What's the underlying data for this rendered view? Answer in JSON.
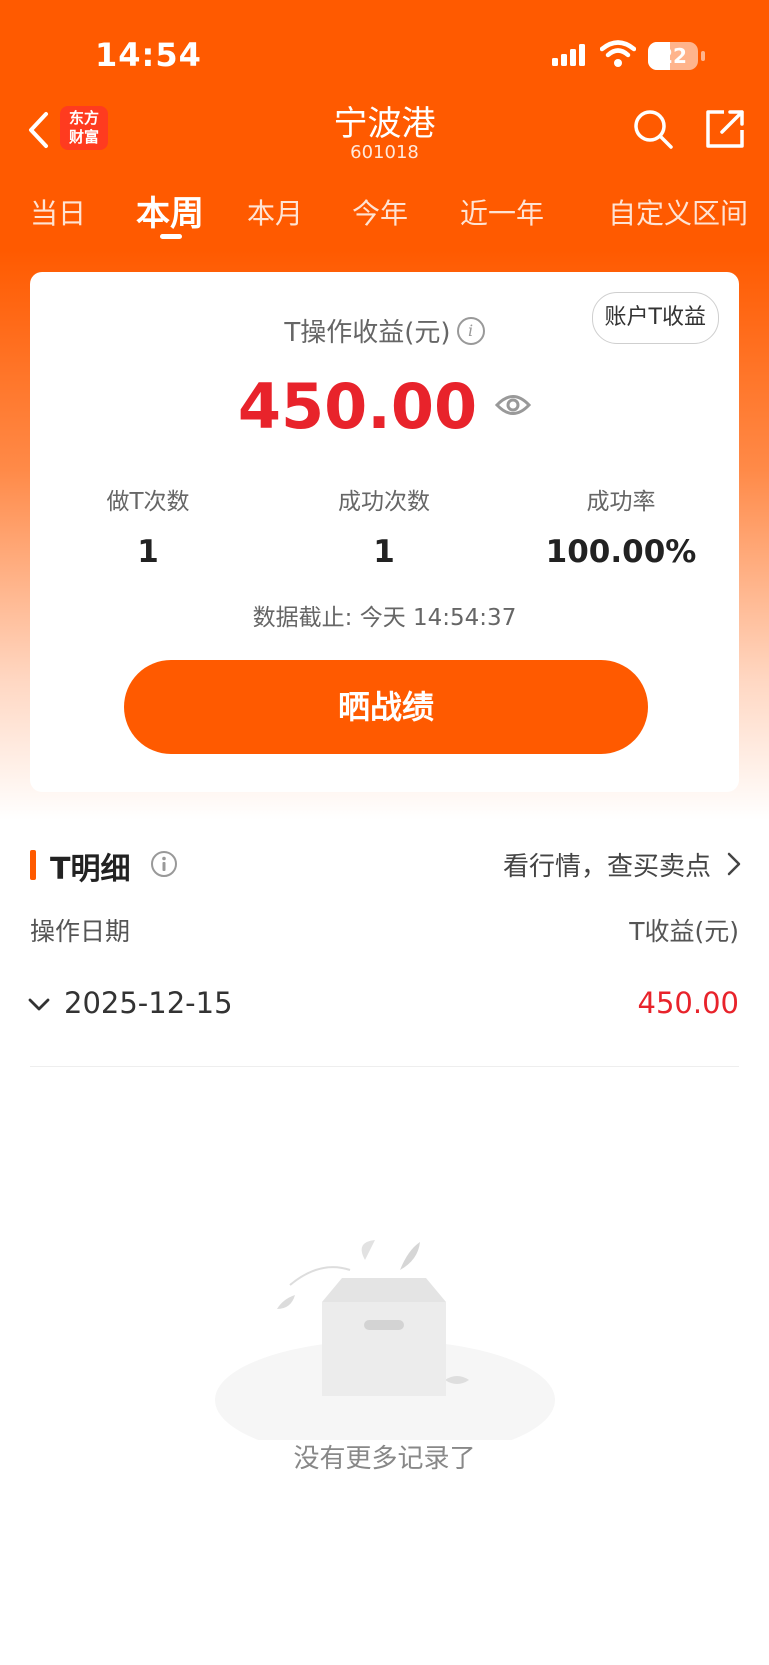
{
  "status_bar": {
    "time": "14:54",
    "battery": "22"
  },
  "nav": {
    "logo_line1": "东方",
    "logo_line2": "财富",
    "title": "宁波港",
    "code": "601018"
  },
  "tabs": [
    {
      "label": "当日",
      "active": false
    },
    {
      "label": "本周",
      "active": true
    },
    {
      "label": "本月",
      "active": false
    },
    {
      "label": "今年",
      "active": false
    },
    {
      "label": "近一年",
      "active": false
    },
    {
      "label": "自定义区间",
      "active": false
    }
  ],
  "card": {
    "account_button": "账户T收益",
    "label": "T操作收益(元)",
    "value": "450.00",
    "stats": [
      {
        "label": "做T次数",
        "value": "1"
      },
      {
        "label": "成功次数",
        "value": "1"
      },
      {
        "label": "成功率",
        "value": "100.00%"
      }
    ],
    "cutoff": "数据截止: 今天 14:54:37",
    "share_button": "晒战绩"
  },
  "detail": {
    "title": "T明细",
    "link": "看行情，查买卖点",
    "col_date": "操作日期",
    "col_value": "T收益(元)",
    "rows": [
      {
        "date": "2025-12-15",
        "value": "450.00"
      }
    ]
  },
  "empty": {
    "text": "没有更多记录了"
  },
  "colors": {
    "brand": "#ff5a00",
    "profit": "#e8232b"
  }
}
